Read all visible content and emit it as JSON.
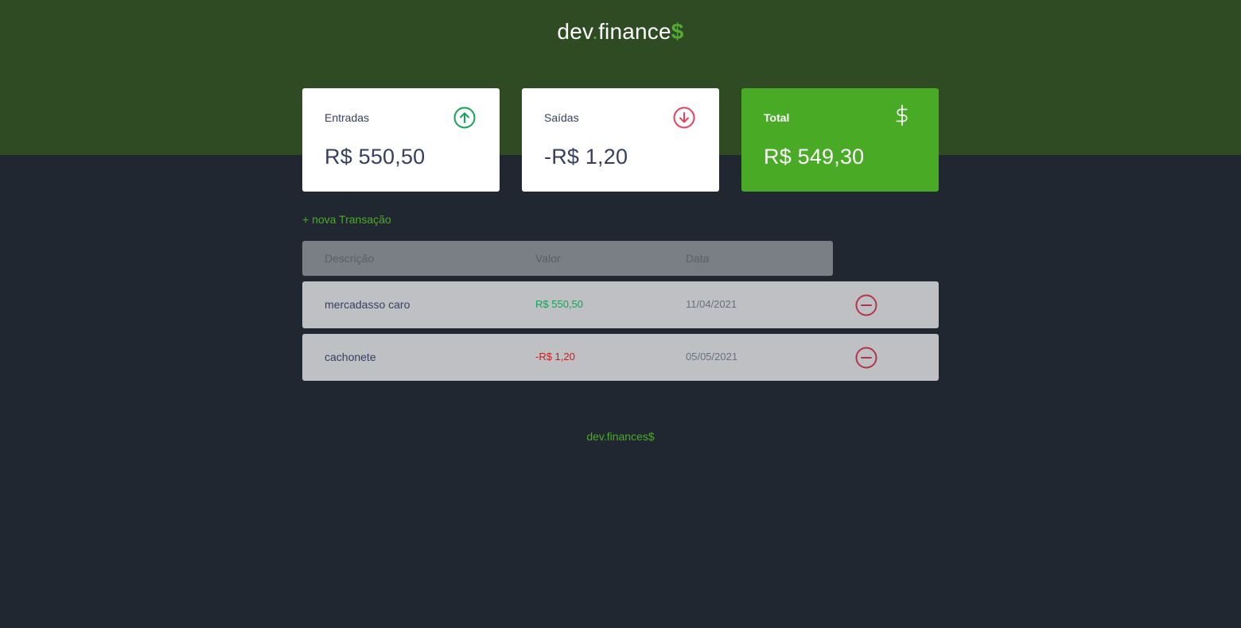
{
  "header": {
    "logo_main": "dev",
    "logo_dot": ".",
    "logo_rest": "finance",
    "logo_dollar": "$"
  },
  "cards": {
    "income": {
      "label": "Entradas",
      "amount": "R$ 550,50",
      "icon": "arrow-up-circle-icon"
    },
    "expense": {
      "label": "Saídas",
      "amount": "-R$ 1,20",
      "icon": "arrow-down-circle-icon"
    },
    "total": {
      "label": "Total",
      "amount": "R$ 549,30",
      "icon": "dollar-sign-icon"
    }
  },
  "new_transaction_label": "+ nova Transação",
  "table": {
    "headers": [
      "Descrição",
      "Valor",
      "Data"
    ],
    "rows": [
      {
        "description": "mercadasso caro",
        "value": "R$ 550,50",
        "type": "income",
        "date": "11/04/2021"
      },
      {
        "description": "cachonete",
        "value": "-R$ 1,20",
        "type": "expense",
        "date": "05/05/2021"
      }
    ]
  },
  "footer": {
    "text": "dev.finances$"
  },
  "colors": {
    "header_bg": "#2f4b24",
    "body_bg": "#212731",
    "accent": "#49aa26",
    "income": "#12a454",
    "expense": "#d01a1a",
    "remove": "#b3354b"
  }
}
